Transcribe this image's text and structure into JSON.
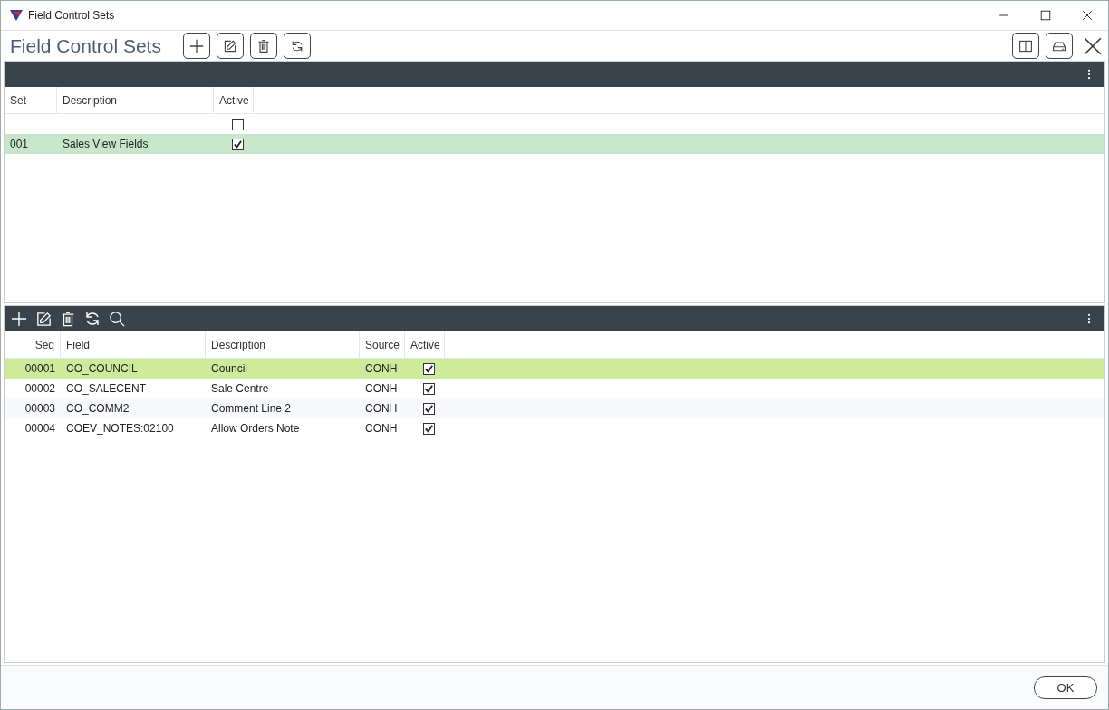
{
  "window": {
    "title": "Field Control Sets"
  },
  "header": {
    "title": "Field Control Sets"
  },
  "sets": {
    "columns": [
      "Set",
      "Description",
      "Active"
    ],
    "filter_row": {
      "active": false
    },
    "rows": [
      {
        "set": "001",
        "description": "Sales View Fields",
        "active": true,
        "selected": true
      }
    ]
  },
  "fields": {
    "columns": [
      "Seq",
      "Field",
      "Description",
      "Source",
      "Active"
    ],
    "rows": [
      {
        "seq": "00001",
        "field": "CO_COUNCIL",
        "description": "Council",
        "source": "CONH",
        "active": true,
        "selected": true
      },
      {
        "seq": "00002",
        "field": "CO_SALECENT",
        "description": "Sale Centre",
        "source": "CONH",
        "active": true,
        "selected": false
      },
      {
        "seq": "00003",
        "field": "CO_COMM2",
        "description": "Comment Line 2",
        "source": "CONH",
        "active": true,
        "selected": false
      },
      {
        "seq": "00004",
        "field": "COEV_NOTES:02100",
        "description": "Allow Orders Note",
        "source": "CONH",
        "active": true,
        "selected": false
      }
    ]
  },
  "footer": {
    "ok_button": "OK"
  }
}
